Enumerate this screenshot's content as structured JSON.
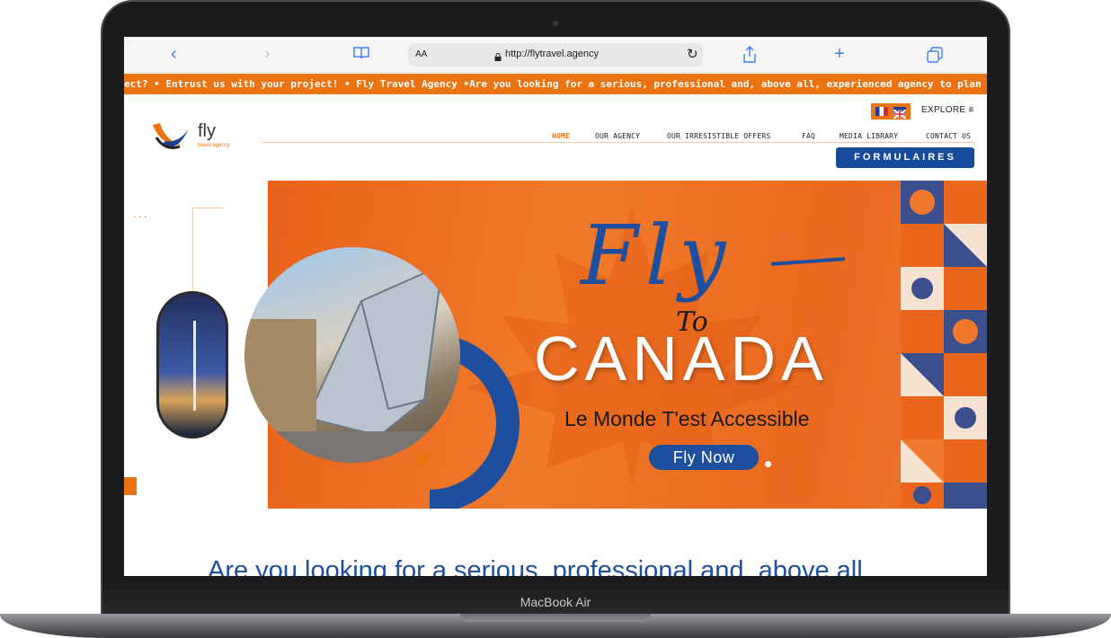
{
  "browser": {
    "back_icon": "chevron-left-icon",
    "forward_icon": "chevron-right-icon",
    "bookmarks_icon": "book-icon",
    "text_size_label": "AA",
    "url": "http://flytravel.agency",
    "reload_icon": "reload-icon",
    "share_icon": "share-icon",
    "new_tab_icon": "plus-icon",
    "tabs_icon": "tabs-icon"
  },
  "marquee": {
    "text": "ect? • Entrust us with your project! • Fly Travel Agency •Are you looking for a serious, professional and, above all, experienced agency to plan and orga"
  },
  "header": {
    "explore_label": "EXPLORE",
    "logo_word": "fly",
    "logo_sub": "travel agency",
    "nav": [
      "HOME",
      "OUR AGENCY",
      "OUR IRRESISTIBLE OFFERS",
      "FAQ",
      "MEDIA LIBRARY",
      "CONTACT US"
    ],
    "forms_button": "FORMULAIRES"
  },
  "hero": {
    "script_title": "Fly",
    "to_word": "To",
    "title": "CANADA",
    "subtitle": "Le Monde T'est Accessible",
    "cta": "Fly Now"
  },
  "below": {
    "heading": "Are you looking for a serious, professional and, above all"
  },
  "device": {
    "model": "MacBook Air"
  },
  "colors": {
    "brand_orange": "#ec7312",
    "brand_blue": "#1d4f9e"
  }
}
